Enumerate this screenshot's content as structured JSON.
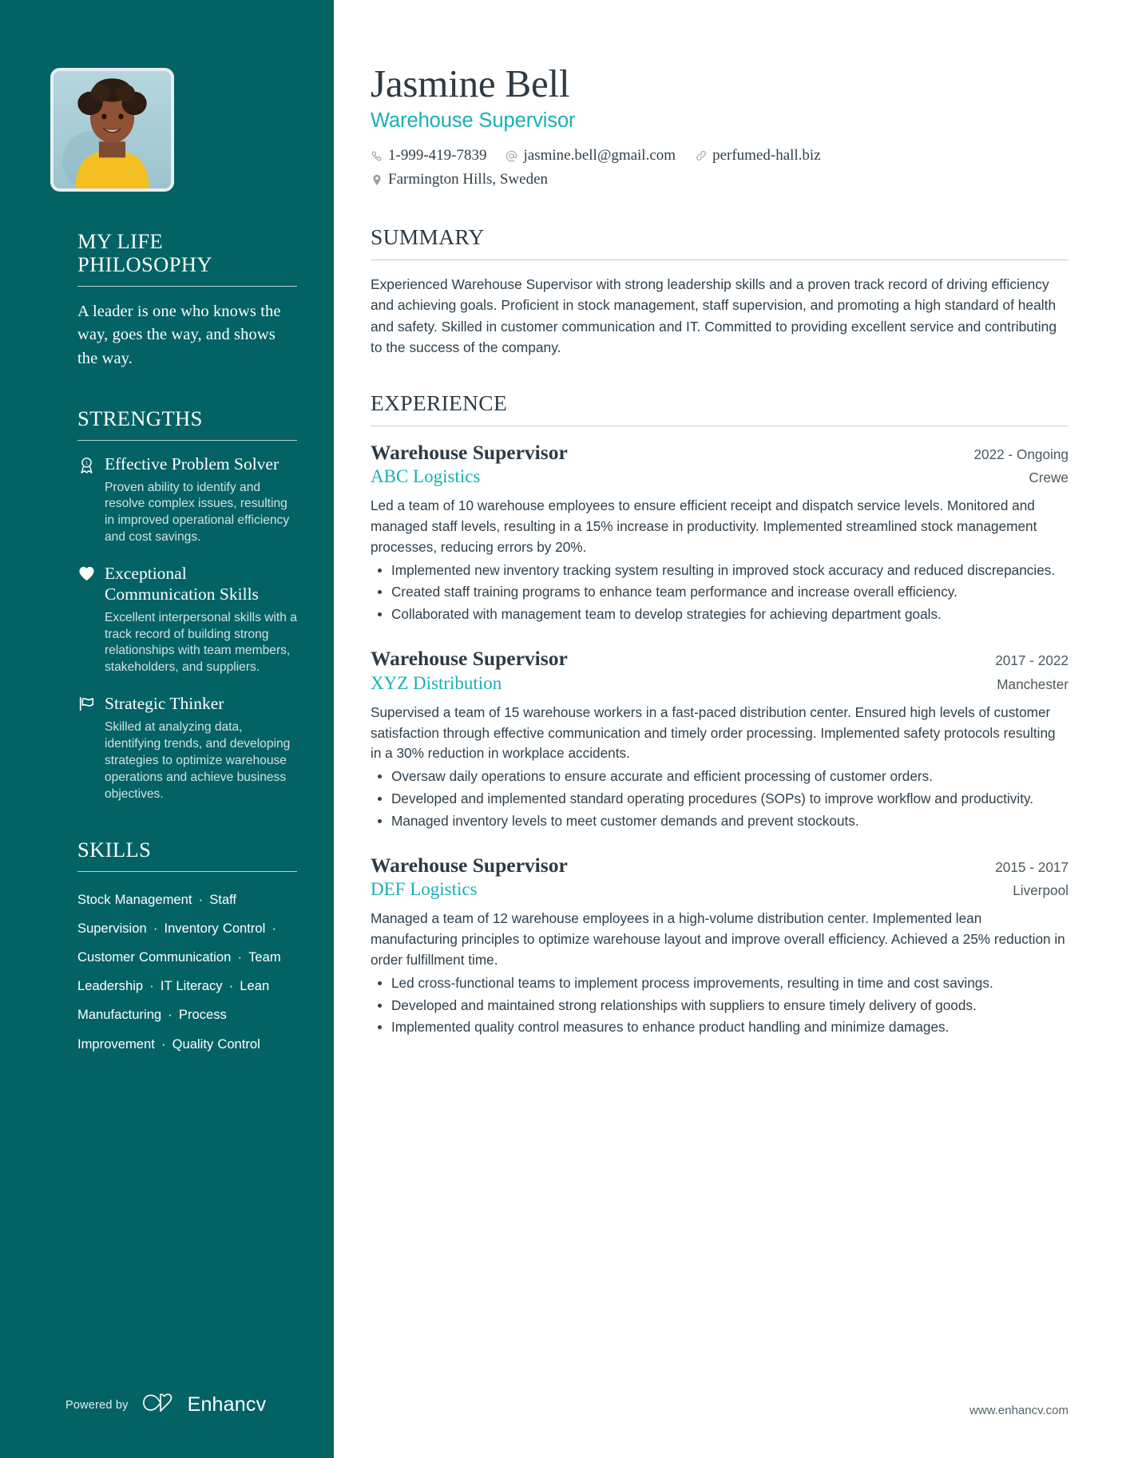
{
  "colors": {
    "sidebar_bg": "#036264",
    "accent_teal": "#17b0b5",
    "heading_dark": "#2e3a44",
    "body_text": "#31404b"
  },
  "header": {
    "name": "Jasmine Bell",
    "role": "Warehouse Supervisor",
    "contacts": [
      {
        "icon": "phone-icon",
        "text": "1-999-419-7839"
      },
      {
        "icon": "at-sign-icon",
        "text": "jasmine.bell@gmail.com"
      },
      {
        "icon": "link-icon",
        "text": "perfumed-hall.biz"
      }
    ],
    "location": {
      "icon": "map-pin-icon",
      "text": "Farmington Hills, Sweden"
    }
  },
  "sidebar": {
    "photo_alt": "portrait-photo",
    "philosophy": {
      "heading": "MY LIFE PHILOSOPHY",
      "quote": "A leader is one who knows the way, goes the way, and shows the way."
    },
    "strengths": {
      "heading": "STRENGTHS",
      "items": [
        {
          "icon": "award-ribbon-icon",
          "title": "Effective Problem Solver",
          "description": "Proven ability to identify and resolve complex issues, resulting in improved operational efficiency and cost savings."
        },
        {
          "icon": "heart-icon",
          "title": "Exceptional Communication Skills",
          "description": "Excellent interpersonal skills with a track record of building strong relationships with team members, stakeholders, and suppliers."
        },
        {
          "icon": "flag-icon",
          "title": "Strategic Thinker",
          "description": "Skilled at analyzing data, identifying trends, and developing strategies to optimize warehouse operations and achieve business objectives."
        }
      ]
    },
    "skills": {
      "heading": "SKILLS",
      "separator": "·",
      "items": [
        "Stock Management",
        "Staff Supervision",
        "Inventory Control",
        "Customer Communication",
        "Team Leadership",
        "IT Literacy",
        "Lean Manufacturing",
        "Process Improvement",
        "Quality Control"
      ]
    },
    "footer": {
      "powered_by": "Powered by",
      "brand": "Enhancv",
      "logo_icon": "enhancv-infinity-heart-icon"
    }
  },
  "main": {
    "summary": {
      "heading": "SUMMARY",
      "text": "Experienced Warehouse Supervisor with strong leadership skills and a proven track record of driving efficiency and achieving goals. Proficient in stock management, staff supervision, and promoting a high standard of health and safety. Skilled in customer communication and IT. Committed to providing excellent service and contributing to the success of the company."
    },
    "experience": {
      "heading": "EXPERIENCE",
      "jobs": [
        {
          "title": "Warehouse Supervisor",
          "company": "ABC Logistics",
          "date": "2022 - Ongoing",
          "location": "Crewe",
          "description": "Led a team of 10 warehouse employees to ensure efficient receipt and dispatch service levels. Monitored and managed staff levels, resulting in a 15% increase in productivity. Implemented streamlined stock management processes, reducing errors by 20%.",
          "bullets": [
            "Implemented new inventory tracking system resulting in improved stock accuracy and reduced discrepancies.",
            "Created staff training programs to enhance team performance and increase overall efficiency.",
            "Collaborated with management team to develop strategies for achieving department goals."
          ]
        },
        {
          "title": "Warehouse Supervisor",
          "company": "XYZ Distribution",
          "date": "2017 - 2022",
          "location": "Manchester",
          "description": "Supervised a team of 15 warehouse workers in a fast-paced distribution center. Ensured high levels of customer satisfaction through effective communication and timely order processing. Implemented safety protocols resulting in a 30% reduction in workplace accidents.",
          "bullets": [
            "Oversaw daily operations to ensure accurate and efficient processing of customer orders.",
            "Developed and implemented standard operating procedures (SOPs) to improve workflow and productivity.",
            "Managed inventory levels to meet customer demands and prevent stockouts."
          ]
        },
        {
          "title": "Warehouse Supervisor",
          "company": "DEF Logistics",
          "date": "2015 - 2017",
          "location": "Liverpool",
          "description": "Managed a team of 12 warehouse employees in a high-volume distribution center. Implemented lean manufacturing principles to optimize warehouse layout and improve overall efficiency. Achieved a 25% reduction in order fulfillment time.",
          "bullets": [
            "Led cross-functional teams to implement process improvements, resulting in time and cost savings.",
            "Developed and maintained strong relationships with suppliers to ensure timely delivery of goods.",
            "Implemented quality control measures to enhance product handling and minimize damages."
          ]
        }
      ]
    },
    "footer_url": "www.enhancv.com"
  }
}
